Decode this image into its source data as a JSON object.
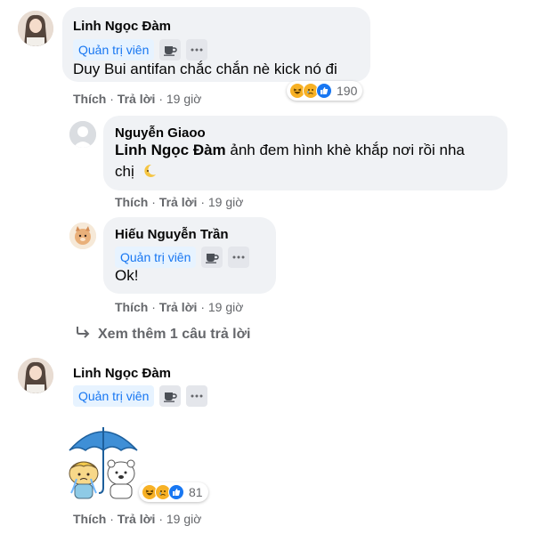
{
  "comments": [
    {
      "author": "Linh Ngọc Đàm",
      "badge": "Quản trị viên",
      "text": "Duy Bui antifan chắc chắn nè kick nó đi",
      "like": "Thích",
      "reply": "Trả lời",
      "time": "19 giờ",
      "reaction_count": "190",
      "reactions": [
        "haha",
        "sad",
        "like"
      ]
    }
  ],
  "replies": [
    {
      "author": "Nguyễn Giaoo",
      "mention": "Linh Ngọc Đàm",
      "text_line1": " ảnh đem hình khè khắp nơi rồi nha",
      "text_line2": "chị",
      "like": "Thích",
      "reply": "Trả lời",
      "time": "19 giờ"
    },
    {
      "author": "Hiếu Nguyễn Trần",
      "badge": "Quản trị viên",
      "text": "Ok!",
      "like": "Thích",
      "reply": "Trả lời",
      "time": "19 giờ"
    }
  ],
  "view_more": "Xem thêm 1 câu trả lời",
  "second_comment": {
    "author": "Linh Ngọc Đàm",
    "badge": "Quản trị viên",
    "sticker": "umbrella-sticker",
    "reaction_count": "81",
    "reactions": [
      "haha",
      "sad",
      "like"
    ],
    "like": "Thích",
    "reply": "Trả lời",
    "time": "19 giờ"
  },
  "colors": {
    "bubble": "#f0f2f5",
    "badge_bg": "#e7f3ff",
    "badge_text": "#1877f2",
    "meta": "#65676b",
    "like_blue": "#1877f2",
    "haha_yellow": "#f7b125"
  }
}
